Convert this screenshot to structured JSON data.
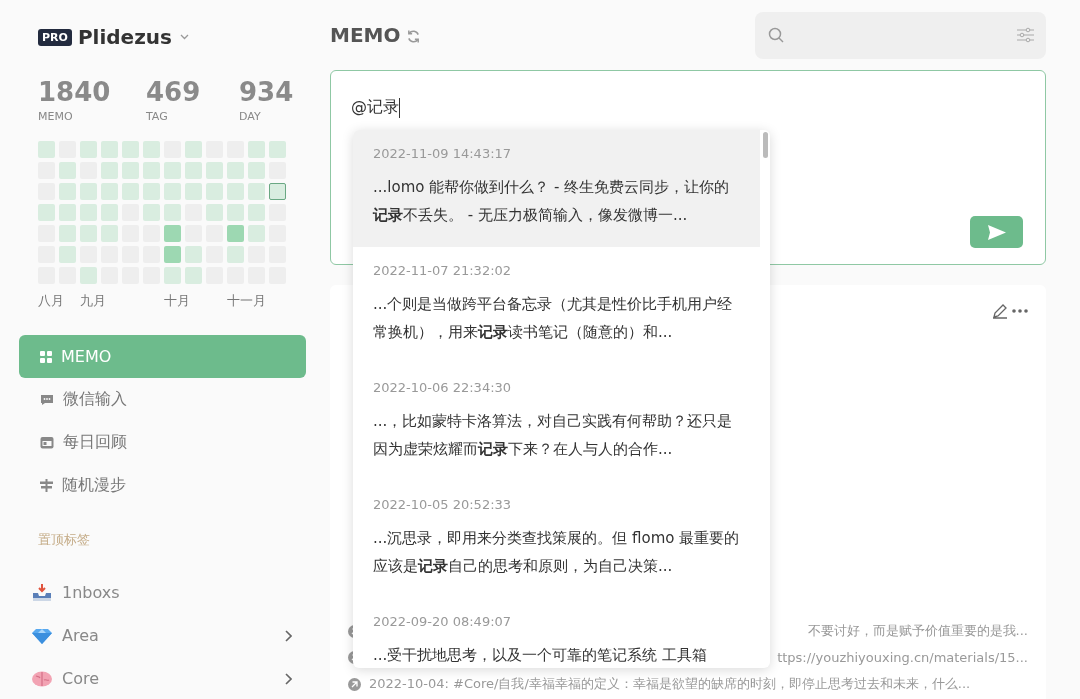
{
  "account": {
    "badge": "PRO",
    "name": "Plidezus"
  },
  "stats": [
    {
      "value": "1840",
      "label": "MEMO"
    },
    {
      "value": "469",
      "label": "TAG"
    },
    {
      "value": "934",
      "label": "DAY"
    }
  ],
  "heatmap": {
    "rows": [
      [
        {
          "color": "#d9ede0",
          "today": false
        },
        {
          "color": "#eeeeee",
          "today": false
        },
        {
          "color": "#d9ede0",
          "today": false
        },
        {
          "color": "#d9ede0",
          "today": false
        },
        {
          "color": "#d9ede0",
          "today": false
        },
        {
          "color": "#d9ede0",
          "today": false
        },
        {
          "color": "#eeeeee",
          "today": false
        },
        {
          "color": "#d9ede0",
          "today": false
        },
        {
          "color": "#eeeeee",
          "today": false
        },
        {
          "color": "#eeeeee",
          "today": false
        },
        {
          "color": "#d9ede0",
          "today": false
        },
        {
          "color": "#d9ede0",
          "today": false
        }
      ],
      [
        {
          "color": "#eeeeee",
          "today": false
        },
        {
          "color": "#d9ede0",
          "today": false
        },
        {
          "color": "#eeeeee",
          "today": false
        },
        {
          "color": "#d9ede0",
          "today": false
        },
        {
          "color": "#d9ede0",
          "today": false
        },
        {
          "color": "#d9ede0",
          "today": false
        },
        {
          "color": "#d9ede0",
          "today": false
        },
        {
          "color": "#d9ede0",
          "today": false
        },
        {
          "color": "#d9ede0",
          "today": false
        },
        {
          "color": "#d9ede0",
          "today": false
        },
        {
          "color": "#d9ede0",
          "today": false
        },
        {
          "color": "#eeeeee",
          "today": false
        }
      ],
      [
        {
          "color": "#eeeeee",
          "today": false
        },
        {
          "color": "#d9ede0",
          "today": false
        },
        {
          "color": "#d9ede0",
          "today": false
        },
        {
          "color": "#d9ede0",
          "today": false
        },
        {
          "color": "#d9ede0",
          "today": false
        },
        {
          "color": "#d9ede0",
          "today": false
        },
        {
          "color": "#d9ede0",
          "today": false
        },
        {
          "color": "#d9ede0",
          "today": false
        },
        {
          "color": "#d9ede0",
          "today": false
        },
        {
          "color": "#d9ede0",
          "today": false
        },
        {
          "color": "#d9ede0",
          "today": false
        },
        {
          "color": "#d9ede0",
          "today": true
        }
      ],
      [
        {
          "color": "#d9ede0",
          "today": false
        },
        {
          "color": "#d9ede0",
          "today": false
        },
        {
          "color": "#d9ede0",
          "today": false
        },
        {
          "color": "#d9ede0",
          "today": false
        },
        {
          "color": "#eeeeee",
          "today": false
        },
        {
          "color": "#d9ede0",
          "today": false
        },
        {
          "color": "#d9ede0",
          "today": false
        },
        {
          "color": "#eeeeee",
          "today": false
        },
        {
          "color": "#d9ede0",
          "today": false
        },
        {
          "color": "#d9ede0",
          "today": false
        },
        {
          "color": "#d9ede0",
          "today": false
        },
        {
          "color": "#eeeeee",
          "today": false
        }
      ],
      [
        {
          "color": "#eeeeee",
          "today": false
        },
        {
          "color": "#d9ede0",
          "today": false
        },
        {
          "color": "#d9ede0",
          "today": false
        },
        {
          "color": "#d9ede0",
          "today": false
        },
        {
          "color": "#eeeeee",
          "today": false
        },
        {
          "color": "#eeeeee",
          "today": false
        },
        {
          "color": "#9dd8b2",
          "today": false
        },
        {
          "color": "#eeeeee",
          "today": false
        },
        {
          "color": "#eeeeee",
          "today": false
        },
        {
          "color": "#9dd8b2",
          "today": false
        },
        {
          "color": "#d9ede0",
          "today": false
        },
        {
          "color": "#eeeeee",
          "today": false
        }
      ],
      [
        {
          "color": "#eeeeee",
          "today": false
        },
        {
          "color": "#d9ede0",
          "today": false
        },
        {
          "color": "#eeeeee",
          "today": false
        },
        {
          "color": "#eeeeee",
          "today": false
        },
        {
          "color": "#eeeeee",
          "today": false
        },
        {
          "color": "#eeeeee",
          "today": false
        },
        {
          "color": "#9dd8b2",
          "today": false
        },
        {
          "color": "#d9ede0",
          "today": false
        },
        {
          "color": "#eeeeee",
          "today": false
        },
        {
          "color": "#d9ede0",
          "today": false
        },
        {
          "color": "#eeeeee",
          "today": false
        },
        {
          "color": "#eeeeee",
          "today": false
        }
      ],
      [
        {
          "color": "#eeeeee",
          "today": false
        },
        {
          "color": "#eeeeee",
          "today": false
        },
        {
          "color": "#d9ede0",
          "today": false
        },
        {
          "color": "#eeeeee",
          "today": false
        },
        {
          "color": "#eeeeee",
          "today": false
        },
        {
          "color": "#eeeeee",
          "today": false
        },
        {
          "color": "#d9ede0",
          "today": false
        },
        {
          "color": "#d9ede0",
          "today": false
        },
        {
          "color": "#eeeeee",
          "today": false
        },
        {
          "color": "#eeeeee",
          "today": false
        },
        {
          "color": "#eeeeee",
          "today": false
        },
        {
          "color": "#eeeeee",
          "today": false
        }
      ]
    ],
    "months": [
      "八月",
      "九月",
      "十月",
      "十一月"
    ]
  },
  "nav": [
    {
      "kind": "grid",
      "label": "MEMO",
      "selected": true
    },
    {
      "kind": "chat",
      "label": "微信输入",
      "selected": false
    },
    {
      "kind": "calendar",
      "label": "每日回顾",
      "selected": false
    },
    {
      "kind": "signpost",
      "label": "随机漫步",
      "selected": false
    }
  ],
  "pinned_tags": {
    "title": "置顶标签",
    "items": [
      {
        "kind": "inbox",
        "label": "1nboxs",
        "expandable": false
      },
      {
        "kind": "gem",
        "label": "Area",
        "expandable": true
      },
      {
        "kind": "brain",
        "label": "Core",
        "expandable": true
      }
    ]
  },
  "header": {
    "title": "MEMO"
  },
  "editor": {
    "value": "@记录"
  },
  "suggestions": [
    {
      "time": "2022-11-09 14:43:17",
      "text": "...lomo 能帮你做到什么？ - 终生免费云同步，让你的**记录**不丢失。 - 无压力极简输入，像发微博一...",
      "selected": true
    },
    {
      "time": "2022-11-07 21:32:02",
      "text": "...个则是当做跨平台备忘录（尤其是性价比手机用户经常换机），用来**记录**读书笔记（随意的）和...",
      "selected": false
    },
    {
      "time": "2022-10-06 22:34:30",
      "text": "...，比如蒙特卡洛算法，对自己实践有何帮助？还只是因为虚荣炫耀而**记录**下来？在人与人的合作...",
      "selected": false
    },
    {
      "time": "2022-10-05 20:52:33",
      "text": "...沉思录，即用来分类查找策展的。但 flomo 最重要的应该是**记录**自己的思考和原则，为自己决策...",
      "selected": false
    },
    {
      "time": "2022-09-20 08:49:07",
      "text": "...受干扰地思考，以及一个可靠的笔记系统 工具箱",
      "selected": false
    }
  ],
  "memo_card": {
    "links": [
      "不要讨好，而是赋予价值重要的是我...",
      "ttps://youzhiyouxing.cn/materials/15...",
      "2022-10-04: #Core/自我/幸福幸福的定义：幸福是欲望的缺席的时刻，即停止思考过去和未来，什么..."
    ]
  }
}
